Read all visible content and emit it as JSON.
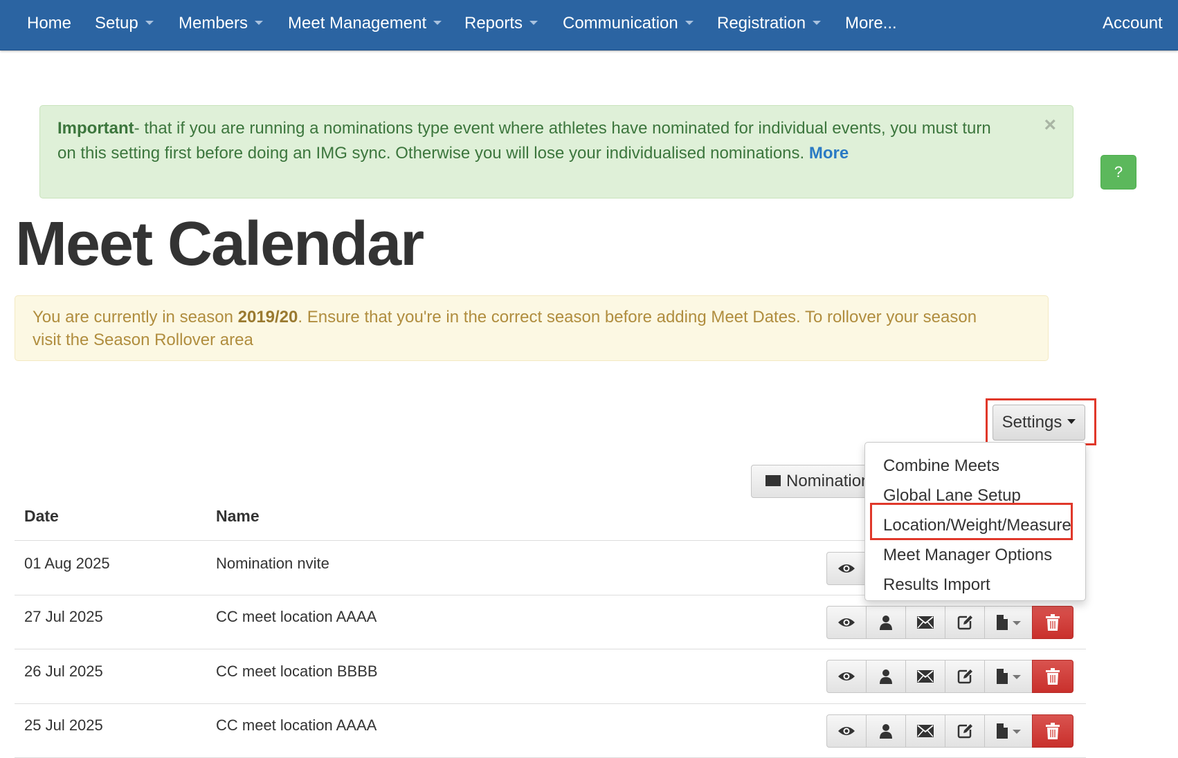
{
  "nav": {
    "items": [
      {
        "label": "Home",
        "dropdown": false
      },
      {
        "label": "Setup",
        "dropdown": true
      },
      {
        "label": "Members",
        "dropdown": true
      },
      {
        "label": "Meet Management",
        "dropdown": true
      },
      {
        "label": "Reports",
        "dropdown": true
      },
      {
        "label": "Communication",
        "dropdown": true
      },
      {
        "label": "Registration",
        "dropdown": true
      },
      {
        "label": "More...",
        "dropdown": false
      }
    ],
    "account": "Account"
  },
  "alert_success": {
    "strong": "Important",
    "text": "- that if you are running a nominations type event where athletes have nominated for individual events, you must turn on this setting first before doing an IMG sync. Otherwise you will lose your individualised nominations. ",
    "more_link": "More",
    "close": "×"
  },
  "help_button": "?",
  "page_title": "Meet Calendar",
  "alert_warning": {
    "text_before": "You are currently in season ",
    "season": "2019/20",
    "text_after": ". Ensure that you're in the correct season before adding Meet Dates. To rollover your season visit the Season Rollover area"
  },
  "settings": {
    "label": "Settings",
    "menu": [
      "Combine Meets",
      "Global Lane Setup",
      "Location/Weight/Measure",
      "Meet Manager Options",
      "Results Import"
    ]
  },
  "nominations_button": "Nominations",
  "table": {
    "headers": {
      "date": "Date",
      "name": "Name"
    },
    "rows": [
      {
        "date": "01 Aug 2025",
        "name": "Nomination nvite"
      },
      {
        "date": "27 Jul 2025",
        "name": "CC meet location AAAA"
      },
      {
        "date": "26 Jul 2025",
        "name": "CC meet location BBBB"
      },
      {
        "date": "25 Jul 2025",
        "name": "CC meet location AAAA"
      }
    ]
  },
  "colors": {
    "navbar": "#2b64a2",
    "success_bg": "#dff0d8",
    "warning_bg": "#fcf8e3",
    "danger": "#d9534f",
    "highlight": "#e0382a"
  }
}
